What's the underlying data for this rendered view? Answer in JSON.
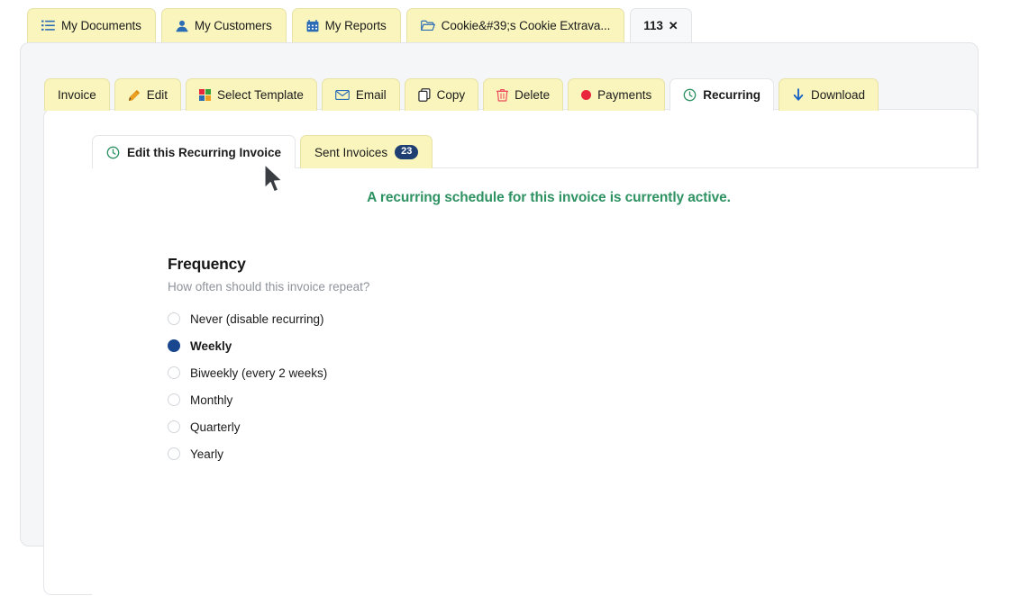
{
  "colors": {
    "tab_yellow": "#f9f5bd",
    "tab_yellow_border": "#e7e2a6",
    "active_white": "#ffffff",
    "panel_gray": "#f5f6f8",
    "status_green": "#2e9262",
    "badge_navy": "#1f3f73",
    "radio_blue": "#18468f",
    "icon_blue": "#2b6cb5",
    "icon_red": "#e8273d",
    "icon_green": "#2e9262",
    "icon_orange": "#f0a020",
    "subtext_gray": "#8e939b"
  },
  "top_tabs": [
    {
      "label": "My Documents",
      "icon": "list-icon",
      "active": false
    },
    {
      "label": "My Customers",
      "icon": "user-icon",
      "active": false
    },
    {
      "label": "My Reports",
      "icon": "calendar-icon",
      "active": false
    },
    {
      "label": "Cookie&#39;s Cookie Extrava...",
      "icon": "folder-icon",
      "active": false
    },
    {
      "label": "113",
      "close_label": "✕",
      "icon": "none",
      "active": true
    }
  ],
  "doc_tabs": [
    {
      "label": "Invoice",
      "icon": "none",
      "active": false
    },
    {
      "label": "Edit",
      "icon": "pencil-icon",
      "active": false
    },
    {
      "label": "Select Template",
      "icon": "template-grid-icon",
      "active": false
    },
    {
      "label": "Email",
      "icon": "envelope-icon",
      "active": false
    },
    {
      "label": "Copy",
      "icon": "copy-icon",
      "active": false
    },
    {
      "label": "Delete",
      "icon": "trash-icon",
      "active": false
    },
    {
      "label": "Payments",
      "icon": "red-dot-icon",
      "active": false
    },
    {
      "label": "Recurring",
      "icon": "clock-icon",
      "active": true
    },
    {
      "label": "Download",
      "icon": "download-arrow-icon",
      "active": false
    }
  ],
  "inner_tabs": [
    {
      "label": "Edit this Recurring Invoice",
      "icon": "clock-icon",
      "badge": "",
      "active": true
    },
    {
      "label": "Sent Invoices",
      "icon": "none",
      "badge": "23",
      "active": false
    }
  ],
  "status": {
    "message": "A recurring schedule for this invoice is currently active."
  },
  "frequency": {
    "heading": "Frequency",
    "subheading": "How often should this invoice repeat?",
    "options": [
      {
        "label": "Never (disable recurring)",
        "selected": false
      },
      {
        "label": "Weekly",
        "selected": true
      },
      {
        "label": "Biweekly (every 2 weeks)",
        "selected": false
      },
      {
        "label": "Monthly",
        "selected": false
      },
      {
        "label": "Quarterly",
        "selected": false
      },
      {
        "label": "Yearly",
        "selected": false
      }
    ]
  }
}
